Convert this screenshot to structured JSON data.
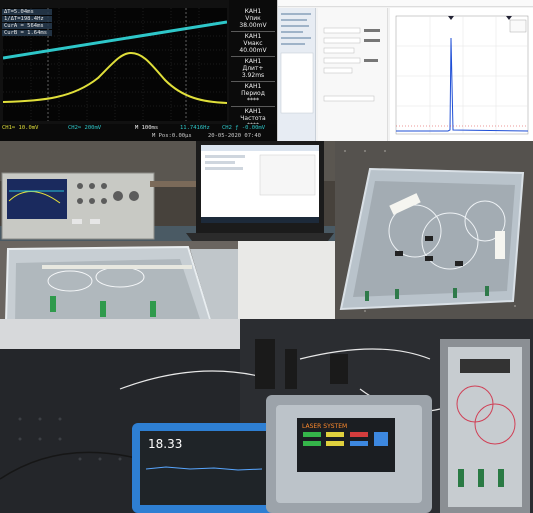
{
  "oscilloscope": {
    "hud": {
      "dt": "ΔT=5.04ms",
      "inv_dt": "1/ΔT=198.4Hz",
      "cur_a": "CurA = 564ms",
      "cur_b": "CurB = 1.64ms"
    },
    "side_panel": [
      {
        "channel": "КАН1",
        "name": "Vпик",
        "value": "38.00mV"
      },
      {
        "channel": "КАН1",
        "name": "Vмакс",
        "value": "40.00mV"
      },
      {
        "channel": "КАН1",
        "name": "Длит+",
        "value": "3.92ms"
      },
      {
        "channel": "КАН1",
        "name": "Период",
        "value": "****"
      },
      {
        "channel": "КАН1",
        "name": "Частота",
        "value": "****"
      }
    ],
    "bottom": {
      "ch1": "CH1≈ 10.0mV",
      "ch2": "CH2≈ 200mV",
      "timebase": "M 100ms",
      "trigger": "11.7416Hz",
      "ch2_trig": "CH2 ƒ -0.00mV",
      "m_pos": "M Pos:0.00μs",
      "datetime": "20-05-2020 07:40"
    },
    "colors": {
      "ch1": "#e0df3a",
      "ch2": "#2ec7c9",
      "hud_bg": "#28405a"
    }
  },
  "device_display": {
    "title": "LASER SYSTEM",
    "readout": "18.33"
  },
  "icons": [
    "laptop-icon",
    "oscilloscope-icon",
    "tablet-icon",
    "laser-controller-icon"
  ]
}
